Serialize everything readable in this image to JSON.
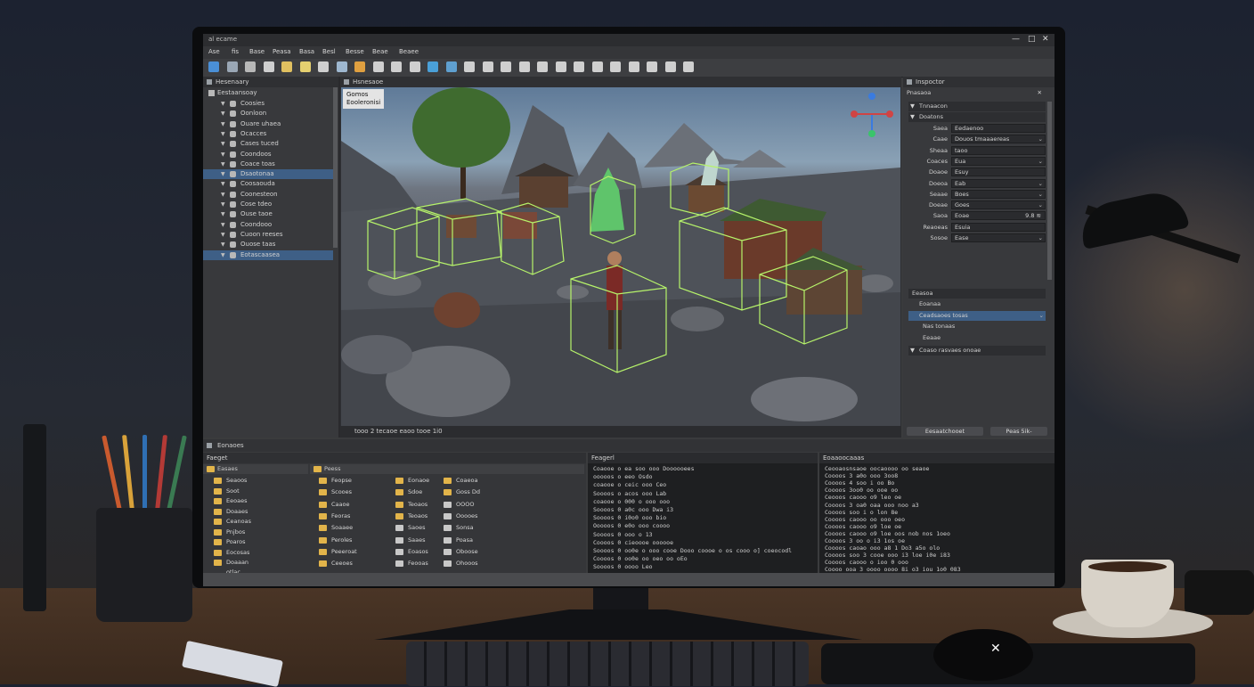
{
  "window": {
    "title": "al ecame",
    "controls": [
      "—",
      "□",
      "✕"
    ]
  },
  "menu": [
    "Ase",
    "fis",
    "Base",
    "Peasa",
    "Basa",
    "Besl",
    "Besse",
    "Beae",
    "Beaee"
  ],
  "toolbar_icons": [
    "play-icon",
    "save-icon",
    "layers-icon",
    "cube-icon",
    "brush-icon",
    "paint-icon",
    "gear-icon",
    "sphere-icon",
    "pencil-icon",
    "grid-icon",
    "move-icon",
    "link-icon",
    "water-icon",
    "shape-icon",
    "paint-bucket-icon",
    "image-icon",
    "graph-icon",
    "book-icon",
    "chat-icon",
    "target-icon",
    "camera-icon",
    "light-icon",
    "wrench-icon",
    "save-disk-icon",
    "package-icon",
    "refresh-icon",
    "image-icon-2"
  ],
  "hierarchy": {
    "title": "Hesenaary",
    "root": "Eestaansoay",
    "items": [
      {
        "label": "Coosies",
        "selected": false
      },
      {
        "label": "Oonloon",
        "selected": false
      },
      {
        "label": "Ouare uhaea",
        "selected": false
      },
      {
        "label": "Ocacces",
        "selected": false
      },
      {
        "label": "Cases tuced",
        "selected": false
      },
      {
        "label": "Coondoos",
        "selected": false
      },
      {
        "label": "Coace toas",
        "selected": false
      },
      {
        "label": "Dsaotonaa",
        "selected": true
      },
      {
        "label": "Coosaouda",
        "selected": false
      },
      {
        "label": "Coonesteon",
        "selected": false
      },
      {
        "label": "Cose tdeo",
        "selected": false
      },
      {
        "label": "Ouse taoe",
        "selected": false
      },
      {
        "label": "Coondooo",
        "selected": false
      },
      {
        "label": "Cuoon reeses",
        "selected": false
      },
      {
        "label": "Ouose taas",
        "selected": false
      },
      {
        "label": "Eotascaasea",
        "selected": true
      }
    ]
  },
  "scene": {
    "title": "Hsnesaoe",
    "gizmo_label_1": "Gomos",
    "gizmo_label_2": "Eooleronisi",
    "footer": "tooo  2 tecaoe eaoo tooe 1i0"
  },
  "inspector": {
    "title": "Inspoctor",
    "object": "Pnasaoa",
    "section_transform": "Tnnaacon",
    "section_2": "Doatons",
    "rows": [
      {
        "label": "Saea",
        "value": "Eedaenoo",
        "dropdown": false
      },
      {
        "label": "Caae",
        "value": "Douos tmaaaereas",
        "dropdown": true
      },
      {
        "label": "Sheaa",
        "value": "taoo",
        "dropdown": false
      },
      {
        "label": "Coaces",
        "value": "Eua",
        "dropdown": true
      },
      {
        "label": "Doaoe",
        "value": "Esuy",
        "dropdown": false
      },
      {
        "label": "Doeoa",
        "value": "Eab",
        "dropdown": true
      },
      {
        "label": "Seaae",
        "value": "Boes",
        "dropdown": true
      },
      {
        "label": "Doeae",
        "value": "Goes",
        "dropdown": true
      },
      {
        "label": "Saoa",
        "value": "Eoae",
        "dropdown": false,
        "extra": "9.8 ≋"
      },
      {
        "label": "Reaoeas",
        "value": "Esuia",
        "dropdown": false
      },
      {
        "label": "Sosoe",
        "value": "Ease",
        "dropdown": true
      }
    ],
    "section_3": "Eeasoa",
    "sub_items": [
      {
        "label": "Eoanaa",
        "dropdown": false
      },
      {
        "label": "Ceadsaoes tosas",
        "dropdown": true
      },
      {
        "label": "Nas tonaas",
        "dropdown": false
      },
      {
        "label": "Eeaae",
        "dropdown": false
      }
    ],
    "section_4": "Coaso rasvaes onoae",
    "button_1": "Eesaatchooet",
    "button_2": "Peas   5ik-"
  },
  "bottom_strip": "Eonaoes",
  "project": {
    "title": "Faeget",
    "tree_header": "Easaes",
    "tree": [
      "Seaoos",
      "Soot",
      "Eeoaes",
      "Doaaes",
      "Ceanoas",
      "Pnjbos",
      "Poaros",
      "Eocosas",
      "Doaaan otlac"
    ],
    "content_header": "Peess",
    "assets": [
      [
        "Feopse",
        "Eonaoe",
        "Coaeoa"
      ],
      [
        "Scooes",
        "Sdoe",
        "Goss Dd"
      ],
      [
        "Caaoe",
        "Teoaos",
        "OOOO"
      ],
      [
        "Feoras",
        "Teoaos",
        "Ooooes"
      ],
      [
        "Soaaee",
        "Saoes",
        "Sonsa"
      ],
      [
        "Peroles",
        "Saaes",
        "Poasa"
      ],
      [
        "Peeeroat",
        "Eoasos",
        "Oboose"
      ],
      [
        "Ceeoes",
        "Feooas",
        "Ohooos"
      ]
    ]
  },
  "console_left": {
    "title": "Feagerl",
    "lines": [
      "Coaooe o ea soo ooo Doooooees",
      "ooooos o eeo Osdo",
      "coaooe o ceic ooo Ceo",
      "Soooos o acos ooo Lab",
      "coaooe o 000 o ooo ooo",
      "Soooos 0 a0c ooo Dwa i3",
      "Soooos 0 i0o0 ooo bio",
      "Ooooos 0 e0o ooo coooo",
      "Soooos 0 ooo o 13",
      "Coooos 0 cieoooe oooooe",
      "Soooos 0 oo0e o ooo cooe  Dooo coooe o os cooo o]  coeocodl",
      "Coooos 0 oo0e oo oeo oo oEo",
      "Soooos 0 oooo Leo",
      "Eooaooe0o4ooD 08"
    ]
  },
  "console_right": {
    "title": "Eoaaoocaaas",
    "lines": [
      "Ceooaosnsaoe oocaoooo oo seaoe",
      "Coooos 3 a0o ooo 3oo8",
      "Coooos 4 soo i oo Bo",
      "Coooos 3oo0 oo ooe oo",
      "Ceooos caooo o9 leo oe",
      "Coooos 3 oa0 oaa ooo noo a3",
      "Coooos soo i o lon 8e",
      "Coooos caooo oo ooo oeo",
      "Coooos caooo o9 loe oe",
      "Coooos caooo o9 loe oos  nob nos 1oeo",
      "Coooos 3 oo o i3 1os oe",
      "Coooos caoao ooo  a8 1 Do3 a5o olo",
      "Coooos soo 3 cooe ooo i3 loe  i0e i83",
      "Coooos caooo o ioo 0 ooo",
      "Coooo ooa 3  oooo  oooo  8i  o3 iou 1o0 083",
      "Cooooo Coooi  Ooae  o0oe oo i3"
    ]
  },
  "colors": {
    "accent": "#3e5f86",
    "folder": "#e2b44a",
    "selection_green": "#b6f36a"
  }
}
